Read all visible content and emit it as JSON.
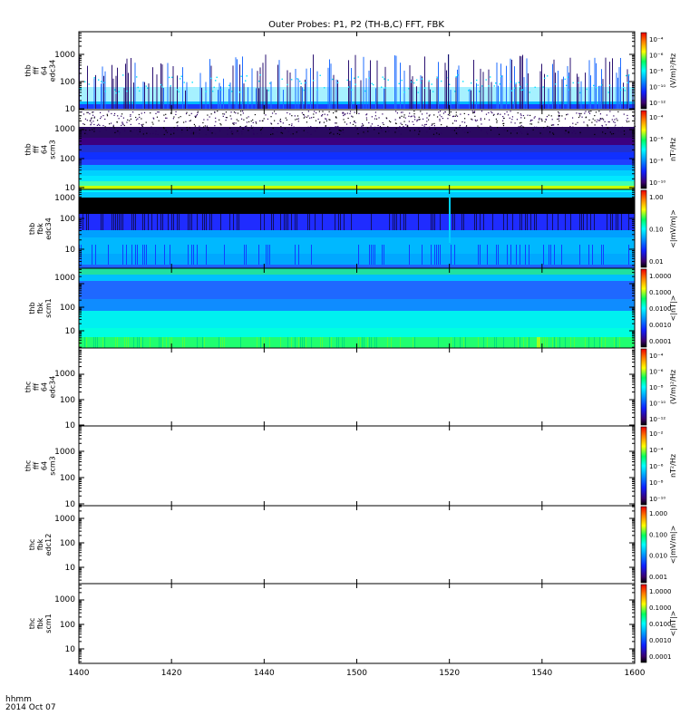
{
  "title": "Outer Probes: P1, P2 (TH-B,C) FFT, FBK",
  "footer": {
    "time_unit": "hhmm",
    "date": "2014 Oct 07"
  },
  "x_ticks": [
    "1400",
    "1420",
    "1440",
    "1500",
    "1520",
    "1540",
    "1600"
  ],
  "chart_data": {
    "type": "heatmap",
    "title": "Outer Probes: P1, P2 (TH-B,C) FFT, FBK",
    "x": {
      "ticks": [
        "1400",
        "1420",
        "1440",
        "1500",
        "1520",
        "1540",
        "1600"
      ],
      "label": "hhmm 2014 Oct 07"
    },
    "panels": [
      {
        "ylabel": [
          "thb",
          "fff",
          "64",
          "edc34"
        ],
        "yticks": [
          "10",
          "100",
          "1000"
        ],
        "yscale": "log",
        "colorbar_label": "(V/m)²/Hz",
        "colorbar_ticks": [
          "10⁻⁴",
          "10⁻⁶",
          "10⁻⁸",
          "10⁻¹⁰",
          "10⁻¹²"
        ],
        "has_data": true,
        "note": "sparse spectral data with frequent vertical spikes up to ~400 Hz"
      },
      {
        "ylabel": [
          "thb",
          "fff",
          "64",
          "scm3"
        ],
        "yticks": [
          "10",
          "100",
          "1000"
        ],
        "yscale": "log",
        "colorbar_label": "nT²/Hz",
        "colorbar_ticks": [
          "10⁻⁴",
          "10⁻⁶",
          "10⁻⁸",
          "10⁻¹⁰"
        ],
        "has_data": true,
        "note": "horizontal bands; yellow/green at lowest frequencies"
      },
      {
        "ylabel": [
          "thb",
          "fbk",
          "edc34"
        ],
        "yticks": [
          "10",
          "100",
          "1000"
        ],
        "yscale": "log",
        "colorbar_label": "<|mV/m|>",
        "colorbar_ticks": [
          "1.00",
          "0.10",
          "0.01"
        ],
        "has_data": true,
        "note": "black band at top, cyan/blue bands below; spike near 1520"
      },
      {
        "ylabel": [
          "thb",
          "fbk",
          "scm1"
        ],
        "yticks": [
          "10",
          "100",
          "1000"
        ],
        "yscale": "log",
        "colorbar_label": "<|nT|>",
        "colorbar_ticks": [
          "1.0000",
          "0.1000",
          "0.0100",
          "0.0010",
          "0.0001"
        ],
        "has_data": true,
        "note": "blue upper bands, cyan/green lower bands"
      },
      {
        "ylabel": [
          "thc",
          "fff",
          "64",
          "edc34"
        ],
        "yticks": [
          "10",
          "100",
          "1000"
        ],
        "yscale": "log",
        "colorbar_label": "(V/m)²/Hz",
        "colorbar_ticks": [
          "10⁻⁴",
          "10⁻⁶",
          "10⁻⁸",
          "10⁻¹⁰",
          "10⁻¹²"
        ],
        "has_data": false
      },
      {
        "ylabel": [
          "thc",
          "fff",
          "64",
          "scm3"
        ],
        "yticks": [
          "10",
          "100",
          "1000"
        ],
        "yscale": "log",
        "colorbar_label": "nT²/Hz",
        "colorbar_ticks": [
          "10⁻²",
          "10⁻⁴",
          "10⁻⁶",
          "10⁻⁸",
          "10⁻¹⁰"
        ],
        "has_data": false
      },
      {
        "ylabel": [
          "thc",
          "fbk",
          "edc12"
        ],
        "yticks": [
          "10",
          "100",
          "1000"
        ],
        "yscale": "log",
        "colorbar_label": "<|mV/m|>",
        "colorbar_ticks": [
          "1.000",
          "0.100",
          "0.010",
          "0.001"
        ],
        "has_data": false
      },
      {
        "ylabel": [
          "thc",
          "fbk",
          "scm1"
        ],
        "yticks": [
          "10",
          "100",
          "1000"
        ],
        "yscale": "log",
        "colorbar_label": "<|nT|>",
        "colorbar_ticks": [
          "1.0000",
          "0.1000",
          "0.0100",
          "0.0010",
          "0.0001"
        ],
        "has_data": false
      }
    ]
  }
}
